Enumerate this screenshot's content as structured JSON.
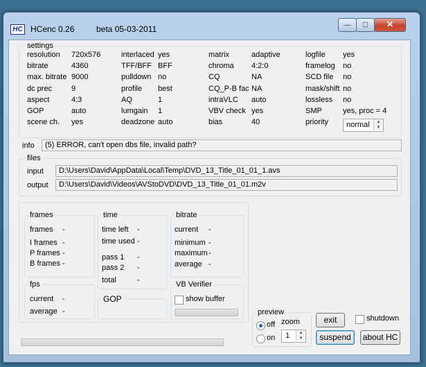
{
  "window": {
    "title_app": "HCenc 0.26",
    "title_beta": "beta 05-03-2011",
    "logo": "HC",
    "minimize_symbol": "—",
    "maximize_symbol": "□",
    "close_symbol": "✕"
  },
  "settings": {
    "label": "settings",
    "rows": [
      [
        "resolution",
        "720x576",
        "interlaced",
        "yes",
        "matrix",
        "adaptive",
        "logfile",
        "yes"
      ],
      [
        "bitrate",
        "4360",
        "TFF/BFF",
        "BFF",
        "chroma",
        "4:2:0",
        "framelog",
        "no"
      ],
      [
        "max. bitrate",
        "9000",
        "pulldown",
        "no",
        "CQ",
        "NA",
        "SCD file",
        "no"
      ],
      [
        "dc prec",
        "9",
        "profile",
        "best",
        "CQ_P-B fac",
        "NA",
        "mask/shift",
        "no"
      ],
      [
        "aspect",
        "4:3",
        "AQ",
        "1",
        "intraVLC",
        "auto",
        "lossless",
        "no"
      ],
      [
        "GOP",
        "auto",
        "lumgain",
        "1",
        "VBV check",
        "yes",
        "SMP",
        "yes,  proc = 4"
      ],
      [
        "scene ch.",
        "yes",
        "deadzone",
        "auto",
        "bias",
        "40",
        "priority",
        ""
      ]
    ],
    "priority_value": "normal"
  },
  "info": {
    "label": "info",
    "message": "(5) ERROR, can't open dbs file, invalid path?"
  },
  "files": {
    "label": "files",
    "input_label": "input",
    "input_path": "D:\\Users\\David\\AppData\\Local\\Temp\\DVD_13_Title_01_01_1.avs",
    "output_label": "output",
    "output_path": "D:\\Users\\David\\Videos\\AVStoDVD\\DVD_13_Title_01_01.m2v"
  },
  "frames": {
    "label": "frames",
    "items": [
      {
        "label": "frames",
        "value": "-"
      },
      {
        "label": "I frames",
        "value": "-"
      },
      {
        "label": "P frames",
        "value": "-"
      },
      {
        "label": "B frames",
        "value": "-"
      }
    ]
  },
  "time": {
    "label": "time",
    "items": [
      {
        "label": "time left",
        "value": "-"
      },
      {
        "label": "time used",
        "value": "-"
      },
      {
        "label": "pass 1",
        "value": "-"
      },
      {
        "label": "pass 2",
        "value": "-"
      },
      {
        "label": "total",
        "value": "-"
      }
    ]
  },
  "bitrate": {
    "label": "bitrate",
    "items": [
      {
        "label": "current",
        "value": "-"
      },
      {
        "label": "minimum",
        "value": "-"
      },
      {
        "label": "maximum",
        "value": "-"
      },
      {
        "label": "average",
        "value": "-"
      }
    ]
  },
  "fps": {
    "label": "fps",
    "items": [
      {
        "label": "current",
        "value": "-"
      },
      {
        "label": "average",
        "value": "-"
      }
    ]
  },
  "gop": {
    "label": "GOP"
  },
  "vbv": {
    "label": "VB Verifier",
    "show_buffer": "show buffer"
  },
  "preview": {
    "label": "preview",
    "off": "off",
    "on": "on",
    "zoom_label": "zoom",
    "zoom_value": "1"
  },
  "buttons": {
    "exit": "exit",
    "suspend": "suspend",
    "about": "about  HC",
    "shutdown": "shutdown"
  }
}
